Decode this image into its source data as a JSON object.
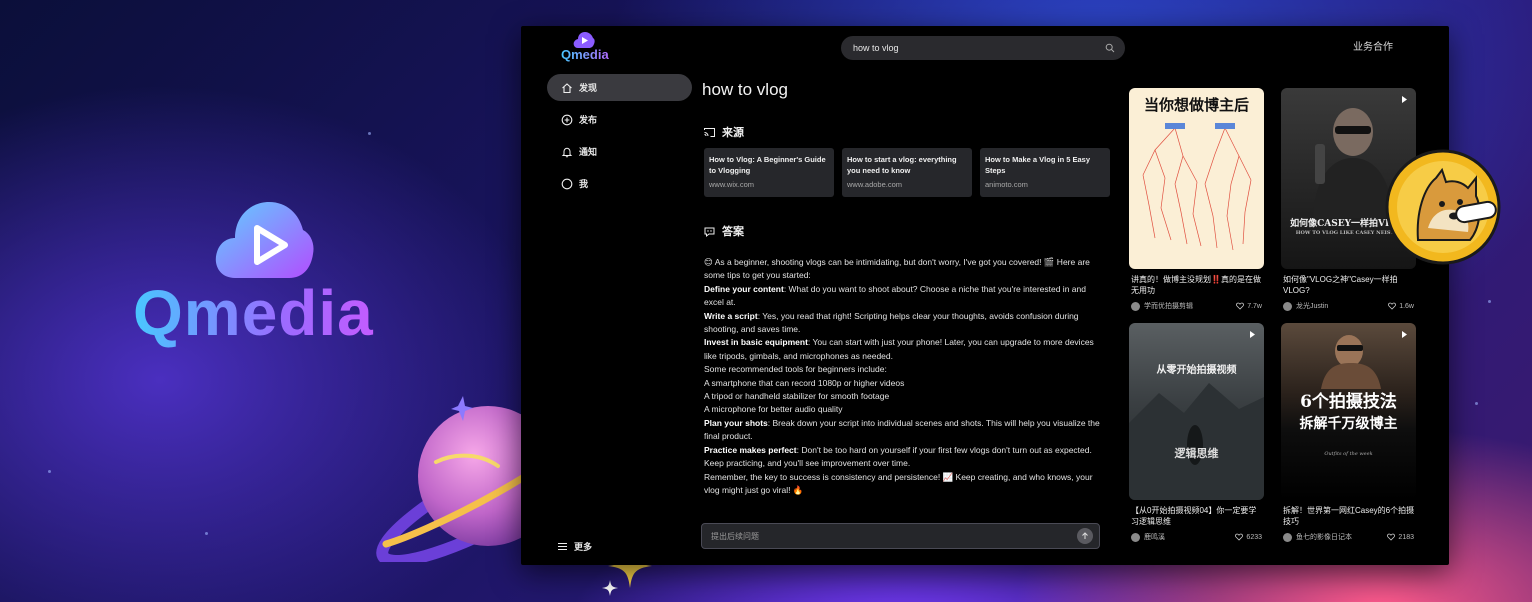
{
  "brand": {
    "name": "Qmedia"
  },
  "app": {
    "logo_text": "Qmedia",
    "search": {
      "value": "how to vlog"
    },
    "business_link": "业务合作",
    "sidebar": {
      "items": [
        {
          "label": "发现",
          "icon": "home-icon",
          "active": true
        },
        {
          "label": "发布",
          "icon": "plus-circle-icon",
          "active": false
        },
        {
          "label": "通知",
          "icon": "bell-icon",
          "active": false
        },
        {
          "label": "我",
          "icon": "user-circle-icon",
          "active": false
        }
      ],
      "more_label": "更多"
    },
    "main": {
      "query_title": "how to vlog",
      "sources_heading": "来源",
      "sources": [
        {
          "title": "How to Vlog: A Beginner's Guide to Vlogging",
          "url": "www.wix.com"
        },
        {
          "title": "How to start a vlog: everything you need to know",
          "url": "www.adobe.com"
        },
        {
          "title": "How to Make a Vlog in 5 Easy Steps",
          "url": "animoto.com"
        }
      ],
      "answer_heading": "答案",
      "answer": {
        "intro": "😊 As a beginner, shooting vlogs can be intimidating, but don't worry, I've got you covered! 🎬 Here are some tips to get you started:",
        "p1_bold": "Define your content",
        "p1_text": ": What do you want to shoot about? Choose a niche that you're interested in and excel at.",
        "p2_bold": "Write a script",
        "p2_text": ": Yes, you read that right! Scripting helps clear your thoughts, avoids confusion during shooting, and saves time.",
        "p3_bold": "Invest in basic equipment",
        "p3_text": ": You can start with just your phone! Later, you can upgrade to more devices like tripods, gimbals, and microphones as needed.",
        "tools_intro": "Some recommended tools for beginners include:",
        "tool1": "A smartphone that can record 1080p or higher videos",
        "tool2": "A tripod or handheld stabilizer for smooth footage",
        "tool3": "A microphone for better audio quality",
        "p4_bold": "Plan your shots",
        "p4_text": ": Break down your script into individual scenes and shots. This will help you visualize the final product.",
        "p5_bold": "Practice makes perfect",
        "p5_text": ": Don't be too hard on yourself if your first few vlogs don't turn out as expected. Keep practicing, and you'll see improvement over time.",
        "closing": "Remember, the key to success is consistency and persistence! 📈 Keep creating, and who knows, your vlog might just go viral! 🔥"
      },
      "followup_placeholder": "提出后续问题"
    },
    "videos": [
      {
        "thumb_headline": "当你想做博主后",
        "title": "讲真的！做博主没规划‼️真的是在做无用功",
        "author": "学而优拍摄剪辑",
        "likes": "7.7w"
      },
      {
        "thumb_headline": "如何像CASEY一样拍VLOG",
        "thumb_sub": "HOW TO VLOG LIKE CASEY NEISTAT",
        "title": "如何像\"VLOG之神\"Casey一样拍VLOG?",
        "author": "龙光Justin",
        "likes": "1.6w"
      },
      {
        "thumb_headline": "从零开始拍摄视频",
        "thumb_sub": "逻辑思维",
        "title": "【从0开始拍摄视频04】你一定要学习逻辑思维",
        "author": "鹿鸣溪",
        "likes": "6233"
      },
      {
        "thumb_headline": "6个拍摄技法",
        "thumb_headline2": "拆解千万级博主",
        "thumb_sub": "Outfits of the week",
        "title": "拆解！世界第一网红Casey的6个拍摄技巧",
        "author": "鱼七的影像日记本",
        "likes": "2183"
      }
    ]
  },
  "colors": {
    "accent_cyan": "#48c8ff",
    "accent_purple": "#9b6bff",
    "accent_pink": "#d057ff",
    "app_bg": "#000000"
  }
}
